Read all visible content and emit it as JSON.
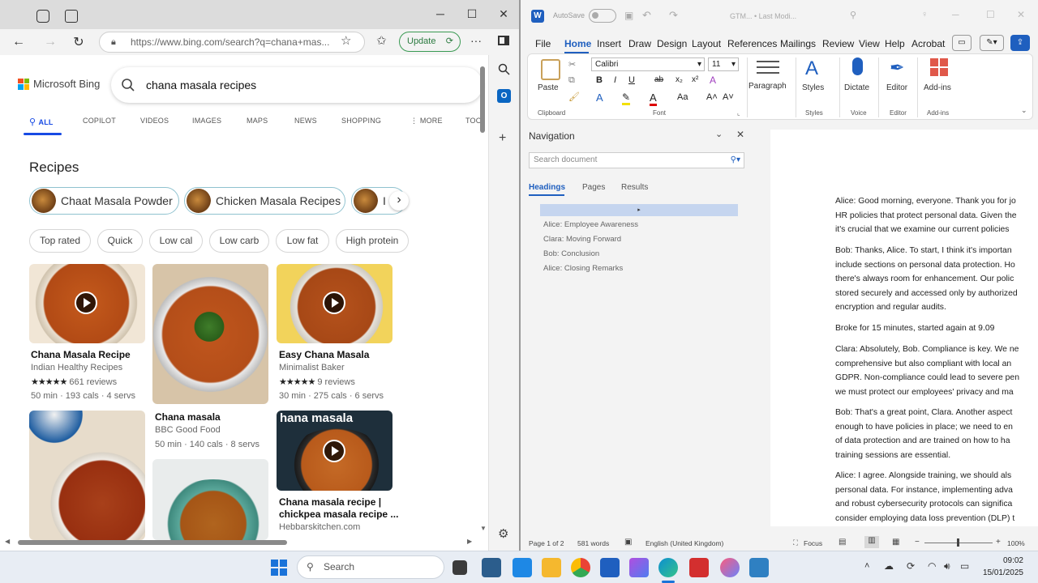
{
  "edge": {
    "url": "https://www.bing.com/search?q=chana+mas...",
    "update_label": "Update",
    "bing_logo": "Microsoft Bing",
    "query": "chana masala recipes",
    "tabs": [
      "ALL",
      "COPILOT",
      "VIDEOS",
      "IMAGES",
      "MAPS",
      "NEWS",
      "SHOPPING",
      "MORE",
      "TOO"
    ],
    "recipes_heading": "Recipes",
    "pills": [
      "Chaat Masala Powder",
      "Chicken Masala Recipes",
      "I"
    ],
    "chips": [
      "Top rated",
      "Quick",
      "Low cal",
      "Low carb",
      "Low fat",
      "High protein"
    ],
    "cards": [
      {
        "title": "Chana Masala Recipe",
        "source": "Indian Healthy Recipes",
        "reviews": "661 reviews",
        "meta": "50 min · 193 cals · 4 servs"
      },
      {
        "title": "Chana masala",
        "source": "BBC Good Food",
        "meta": "50 min · 140 cals · 8 servs"
      },
      {
        "title": "Easy Chana Masala",
        "source": "Minimalist Baker",
        "reviews": "9 reviews",
        "meta": "30 min · 275 cals · 6 servs"
      },
      {
        "overlay": "hana masala",
        "title": "Chana masala recipe |",
        "title2": "chickpea masala recipe ...",
        "source": "Hebbarskitchen.com"
      }
    ],
    "stars": "★★★★★"
  },
  "word": {
    "autosave": "AutoSave",
    "doc_title": "GTM... • Last Modi...",
    "menu": [
      "File",
      "Home",
      "Insert",
      "Draw",
      "Design",
      "Layout",
      "References",
      "Mailings",
      "Review",
      "View",
      "Help",
      "Acrobat"
    ],
    "font_name": "Calibri",
    "font_size": "11",
    "ribbon": {
      "paste": "Paste",
      "paragraph": "Paragraph",
      "styles": "Styles",
      "dictate": "Dictate",
      "editor": "Editor",
      "addins": "Add-ins"
    },
    "ribbon_groups": [
      "Clipboard",
      "Font",
      "Styles",
      "Voice",
      "Editor",
      "Add-ins"
    ],
    "nav": {
      "title": "Navigation",
      "search_placeholder": "Search document",
      "tabs": [
        "Headings",
        "Pages",
        "Results"
      ],
      "headings": [
        "Alice: Employee Awareness",
        "Clara: Moving Forward",
        "Bob: Conclusion",
        "Alice: Closing Remarks"
      ]
    },
    "doc_lines": [
      [
        "Alice: Good morning, everyone. Thank you for jo",
        "HR policies that protect personal data. Given the",
        "it's crucial that we examine our current policies"
      ],
      [
        "Bob: Thanks, Alice. To start, I think it's importan",
        "include sections on personal data protection. Ho",
        "there's always room for enhancement. Our polic",
        "stored securely and accessed only by authorized",
        "encryption and regular audits."
      ],
      [
        "Broke for 15 minutes, started again at 9.09"
      ],
      [
        "Clara: Absolutely, Bob. Compliance is key. We ne",
        "comprehensive but also compliant with local an",
        "GDPR. Non-compliance could lead to severe pen",
        "we must protect our employees' privacy and ma"
      ],
      [
        "Bob: That's a great point, Clara. Another aspect",
        "enough to have policies in place; we need to en",
        "of data protection and are trained on how to ha",
        "training sessions are essential."
      ],
      [
        "Alice: I agree. Alongside training, we should als",
        "personal data. For instance, implementing adva",
        "and robust cybersecurity protocols can significa",
        "consider employing data loss prevention (DLP) t"
      ]
    ],
    "status": {
      "page": "Page 1 of 2",
      "words": "581 words",
      "lang": "English (United Kingdom)",
      "focus": "Focus",
      "zoom": "100%"
    }
  },
  "taskbar": {
    "search": "Search",
    "time": "09:02",
    "date": "15/01/2025"
  }
}
